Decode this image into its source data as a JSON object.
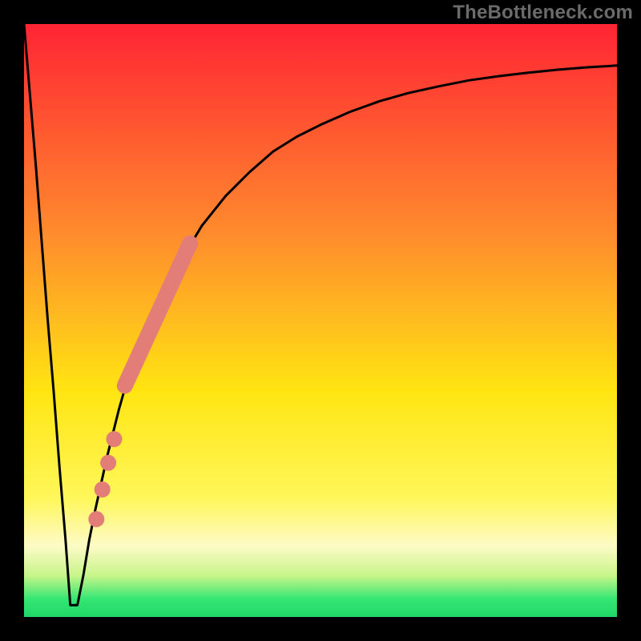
{
  "watermark": "TheBottleneck.com",
  "chart_data": {
    "type": "line",
    "title": "",
    "xlabel": "",
    "ylabel": "",
    "xlim": [
      0,
      100
    ],
    "ylim": [
      0,
      100
    ],
    "grid": false,
    "series": [
      {
        "name": "curve",
        "x": [
          0,
          1,
          2,
          3,
          4,
          5,
          6,
          7,
          7.8,
          8.5,
          9,
          10,
          11,
          12,
          14,
          16,
          18,
          20,
          22,
          24,
          27,
          30,
          34,
          38,
          42,
          46,
          50,
          55,
          60,
          65,
          70,
          75,
          80,
          85,
          90,
          95,
          100
        ],
        "y": [
          100,
          88,
          76,
          63,
          50,
          38,
          25,
          13,
          2,
          2,
          2,
          7,
          13,
          18,
          27,
          35,
          42,
          47,
          52,
          56,
          61,
          66,
          71,
          75,
          78.5,
          81,
          83,
          85.2,
          87,
          88.4,
          89.5,
          90.5,
          91.2,
          91.8,
          92.3,
          92.7,
          93
        ]
      }
    ],
    "highlight_segment": {
      "name": "overlay-band",
      "description": "thick coral overlay on the rising part of the curve",
      "x": [
        17,
        28
      ],
      "y": [
        39,
        63
      ]
    },
    "highlight_points": {
      "name": "overlay-dots",
      "points": [
        {
          "x": 15.2,
          "y": 30
        },
        {
          "x": 14.2,
          "y": 26
        },
        {
          "x": 13.2,
          "y": 21.5
        },
        {
          "x": 12.2,
          "y": 16.5
        }
      ]
    },
    "colors": {
      "gradient_top": "#ff2434",
      "gradient_mid_upper": "#ff9a2a",
      "gradient_mid": "#ffe512",
      "gradient_low": "#fdfac7",
      "gradient_green": "#2ae66b",
      "curve": "#000000",
      "overlay": "#e27e77",
      "frame": "#000000"
    }
  }
}
